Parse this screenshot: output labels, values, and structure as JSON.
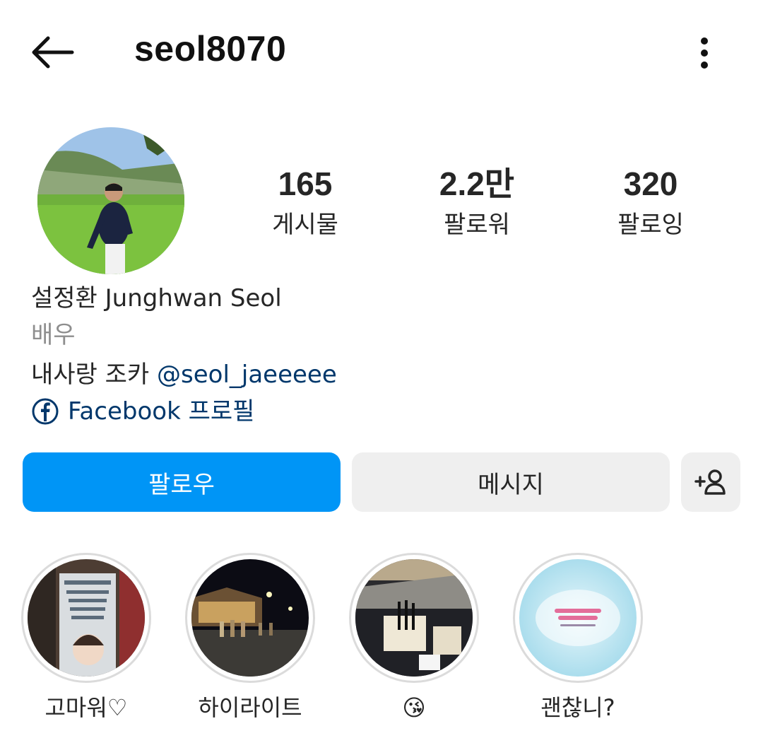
{
  "header": {
    "username": "seol8070",
    "back_icon": "arrow-left-icon",
    "more_icon": "vertical-dots-icon"
  },
  "profile": {
    "avatar": "profile-photo",
    "stats": [
      {
        "value": "165",
        "label": "게시물"
      },
      {
        "value": "2.2만",
        "label": "팔로워"
      },
      {
        "value": "320",
        "label": "팔로잉"
      }
    ],
    "name": "설정환 Junghwan Seol",
    "category": "배우",
    "bio_text": "내사랑 조카 ",
    "bio_mention": "@seol_jaeeeee",
    "link_text": "Facebook 프로필",
    "link_icon": "facebook-icon"
  },
  "actions": {
    "follow_label": "팔로우",
    "message_label": "메시지",
    "suggest_icon": "add-person-icon",
    "follow_color": "#0095f6"
  },
  "highlights": [
    {
      "label": "고마워♡"
    },
    {
      "label": "하이라이트"
    },
    {
      "label": "😘"
    },
    {
      "label": "괜찮니?"
    }
  ]
}
